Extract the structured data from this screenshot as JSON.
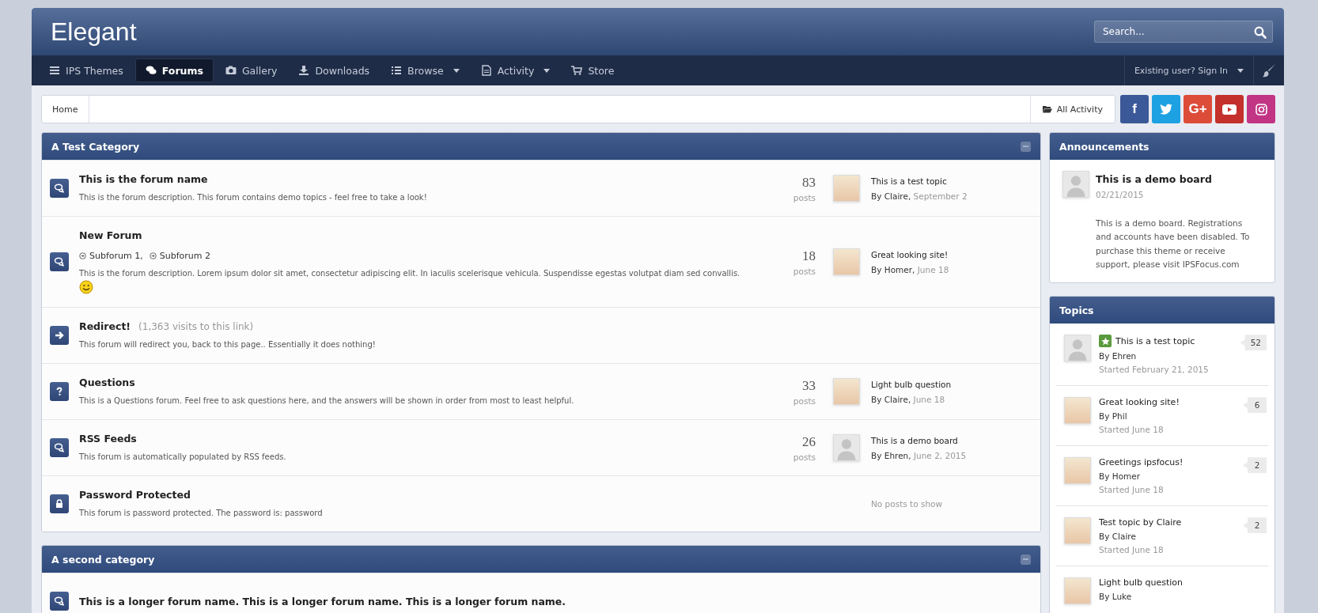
{
  "header": {
    "logo": "Elegant",
    "search": {
      "placeholder": "Search..."
    }
  },
  "nav": {
    "items": [
      {
        "label": "IPS Themes",
        "selected": false
      },
      {
        "label": "Forums",
        "selected": true
      },
      {
        "label": "Gallery",
        "selected": false
      },
      {
        "label": "Downloads",
        "selected": false
      },
      {
        "label": "Browse",
        "selected": false,
        "dropdown": true
      },
      {
        "label": "Activity",
        "selected": false,
        "dropdown": true
      },
      {
        "label": "Store",
        "selected": false
      }
    ],
    "sign_in": {
      "label": "Existing user? Sign In",
      "dropdown": true
    }
  },
  "breadcrumb": {
    "items": [
      "Home"
    ],
    "all_activity": "All Activity"
  },
  "social": [
    {
      "kind": "facebook",
      "label": "f",
      "color": "#3b5998"
    },
    {
      "kind": "twitter",
      "color": "#1da1e2"
    },
    {
      "kind": "googleplus",
      "label": "G+",
      "color": "#dd4b39"
    },
    {
      "kind": "youtube",
      "color": "#c4302b"
    },
    {
      "kind": "instagram",
      "color": "#c13584"
    }
  ],
  "categories": [
    {
      "title": "A Test Category",
      "forums": [
        {
          "kind": "forum",
          "name": "This is the forum name",
          "description": "This is the forum description. This forum contains demo topics - feel free to take a look!",
          "posts": "83",
          "posts_label": "posts",
          "last_post": {
            "title": "This is a test topic",
            "author": "By Claire,",
            "date": "September 2",
            "photo": true
          }
        },
        {
          "kind": "forum",
          "name": "New Forum",
          "subforums": [
            "Subforum 1,",
            "Subforum 2"
          ],
          "description": "This is the forum description. Lorem ipsum dolor sit amet, consectetur adipiscing elit. In iaculis scelerisque vehicula. Suspendisse egestas volutpat diam sed convallis.",
          "emoji": true,
          "posts": "18",
          "posts_label": "posts",
          "last_post": {
            "title": "Great looking site!",
            "author": "By Homer,",
            "date": "June 18",
            "photo": true
          }
        },
        {
          "kind": "redirect",
          "name": "Redirect!",
          "note": "(1,363 visits to this link)",
          "description": "This forum will redirect you, back to this page.. Essentially it does nothing!"
        },
        {
          "kind": "question",
          "name": "Questions",
          "description": "This is a Questions forum. Feel free to ask questions here, and the answers will be shown in order from most to least helpful.",
          "posts": "33",
          "posts_label": "posts",
          "last_post": {
            "title": "Light bulb question",
            "author": "By Claire,",
            "date": "June 18",
            "photo": true
          }
        },
        {
          "kind": "forum",
          "name": "RSS Feeds",
          "description": "This forum is automatically populated by RSS feeds.",
          "posts": "26",
          "posts_label": "posts",
          "last_post": {
            "title": "This is a demo board",
            "author": "By Ehren,",
            "date": "June 2, 2015",
            "photo": false
          }
        },
        {
          "kind": "password",
          "name": "Password Protected",
          "description": "This forum is password protected. The password is: password",
          "no_posts": "No posts to show"
        }
      ]
    },
    {
      "title": "A second category",
      "forums": [
        {
          "kind": "forum",
          "name": "This is a longer forum name. This is a longer forum name. This is a longer forum name."
        }
      ]
    }
  ],
  "announcements": {
    "title": "Announcements",
    "items": [
      {
        "title": "This is a demo board",
        "date": "02/21/2015",
        "body": "This is a demo board. Registrations and accounts have been disabled. To purchase this theme or receive support, please visit IPSFocus.com",
        "photo": false
      }
    ]
  },
  "topics": {
    "title": "Topics",
    "items": [
      {
        "title": "This is a test topic",
        "featured": true,
        "author": "By Ehren",
        "started": "Started February 21, 2015",
        "replies": "52",
        "photo": false
      },
      {
        "title": "Great looking site!",
        "author": "By Phil",
        "started": "Started June 18",
        "replies": "6",
        "photo": true
      },
      {
        "title": "Greetings ipsfocus!",
        "author": "By Homer",
        "started": "Started June 18",
        "replies": "2",
        "photo": true
      },
      {
        "title": "Test topic by Claire",
        "author": "By Claire",
        "started": "Started June 18",
        "replies": "2",
        "photo": true
      },
      {
        "title": "Light bulb question",
        "author": "By Luke",
        "photo": true
      }
    ]
  }
}
